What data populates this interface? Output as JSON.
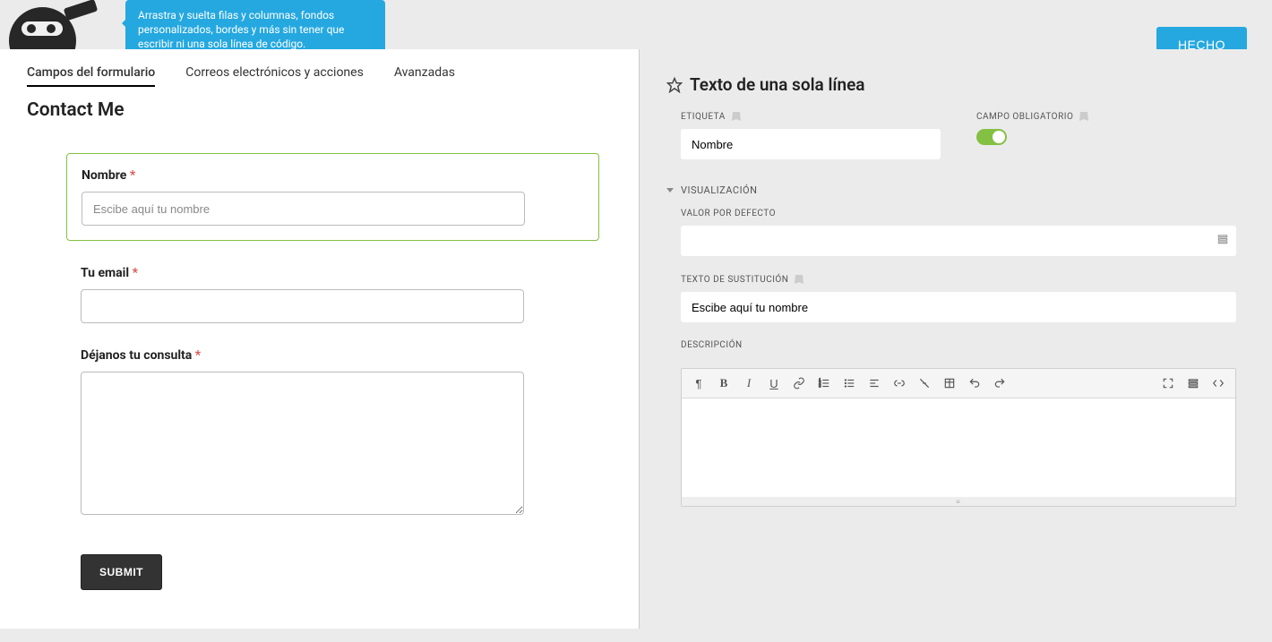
{
  "tooltip": "Arrastra y suelta filas y columnas, fondos personalizados, bordes y más sin tener que escribir ni una sola línea de código.",
  "done_button": "HECHO",
  "tabs": {
    "fields": "Campos del formulario",
    "emails": "Correos electrónicos y acciones",
    "advanced": "Avanzadas"
  },
  "form_title": "Contact Me",
  "fields": {
    "name": {
      "label": "Nombre",
      "placeholder": "Escibe aquí tu nombre"
    },
    "email": {
      "label": "Tu email"
    },
    "message": {
      "label": "Déjanos tu consulta"
    }
  },
  "submit": "SUBMIT",
  "right": {
    "section_title": "Texto de una sola línea",
    "etiqueta_label": "ETIQUETA",
    "etiqueta_value": "Nombre",
    "required_label": "CAMPO OBLIGATORIO",
    "visualizacion": "VISUALIZACIÓN",
    "valor_defecto": "VALOR POR DEFECTO",
    "valor_defecto_value": "",
    "texto_sustitucion": "TEXTO DE SUSTITUCIÓN",
    "texto_sustitucion_value": "Escibe aquí tu nombre",
    "descripcion": "DESCRIPCIÓN"
  }
}
